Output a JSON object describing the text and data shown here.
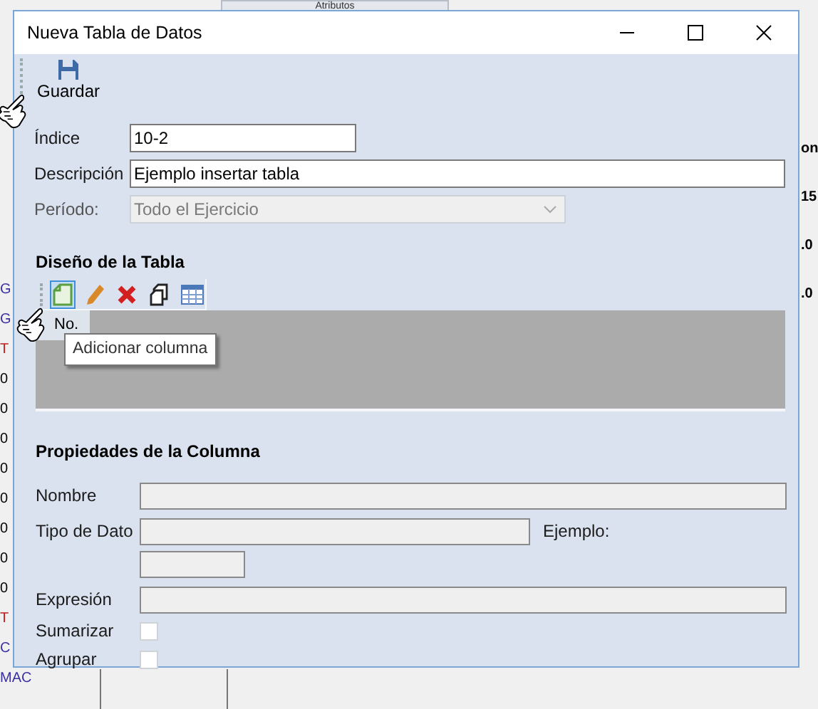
{
  "background": {
    "tab": "Atributos",
    "left_cells": [
      {
        "text": "G",
        "color": "#3a2fa0"
      },
      {
        "text": "G",
        "color": "#3a2fa0"
      },
      {
        "text": "T",
        "color": "#c02020"
      },
      {
        "text": "0",
        "color": "#000000"
      },
      {
        "text": "0",
        "color": "#000000"
      },
      {
        "text": "0",
        "color": "#000000"
      },
      {
        "text": "0",
        "color": "#000000"
      },
      {
        "text": "0",
        "color": "#000000"
      },
      {
        "text": "0",
        "color": "#000000"
      },
      {
        "text": "0",
        "color": "#000000"
      },
      {
        "text": "0",
        "color": "#000000"
      },
      {
        "text": "T",
        "color": "#c02020"
      },
      {
        "text": "C",
        "color": "#3a2fa0"
      },
      {
        "text": "MAC",
        "color": "#3a2fa0"
      }
    ],
    "right_cells": [
      "on",
      "15",
      ".0",
      ".0"
    ]
  },
  "dialog": {
    "title": "Nueva Tabla de Datos",
    "toolbar": {
      "save": "Guardar"
    },
    "fields": [
      {
        "label": "Índice",
        "value": "10-2",
        "kind": "short"
      },
      {
        "label": "Descripción",
        "value": "Ejemplo insertar tabla",
        "kind": "long"
      },
      {
        "label": "Período:",
        "value": "Todo el Ejercicio",
        "kind": "select",
        "disabled": true
      }
    ],
    "design": {
      "title": "Diseño de la Tabla",
      "tools": [
        {
          "kind": "add",
          "selected": true
        },
        {
          "kind": "edit",
          "selected": false
        },
        {
          "kind": "delete",
          "selected": false
        },
        {
          "kind": "copy",
          "selected": false
        },
        {
          "kind": "grid",
          "selected": false
        }
      ],
      "columns": [
        "No."
      ],
      "tooltip": "Adicionar columna"
    },
    "properties": {
      "title": "Propiedades de la Columna",
      "nombre": "Nombre",
      "tipo": "Tipo de Dato",
      "ejemplo": "Ejemplo:",
      "expresion": "Expresión",
      "checks": [
        {
          "label": "Sumarizar",
          "checked": false
        },
        {
          "label": "Agrupar",
          "checked": false
        }
      ]
    }
  }
}
